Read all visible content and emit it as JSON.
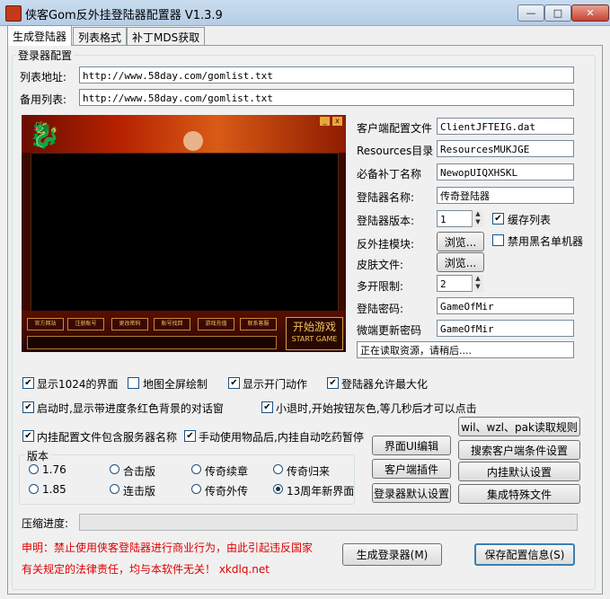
{
  "window": {
    "title": "侠客Gom反外挂登陆器配置器 V1.3.9",
    "min_glyph": "—",
    "max_glyph": "□",
    "close_glyph": "✕",
    "accent": "#c23a19"
  },
  "tabs": [
    "生成登陆器",
    "列表格式",
    "补丁MDS获取"
  ],
  "group_title": "登录器配置",
  "list": {
    "primary_label": "列表地址:",
    "primary_value": "http://www.58day.com/gomlist.txt",
    "backup_label": "备用列表:",
    "backup_value": "http://www.58day.com/gomlist.txt"
  },
  "preview": {
    "min_glyph": "_",
    "close_glyph": "x",
    "buttons": [
      "官方网站",
      "注册账号",
      "更改密码",
      "账号找回",
      "游戏充值",
      "联系客服"
    ],
    "start_line1": "开始游戏",
    "start_line2": "START GAME"
  },
  "right": {
    "client_config_label": "客户端配置文件",
    "client_config_value": "ClientJFTEIG.dat",
    "resources_label": "Resources目录",
    "resources_value": "ResourcesMUKJGE",
    "patch_label": "必备补丁名称",
    "patch_value": "NewopUIQXHSKL",
    "launcher_name_label": "登陆器名称:",
    "launcher_name_value": "传奇登陆器",
    "version_label": "登陆器版本:",
    "version_value": "1",
    "cache_list_label": "缓存列表",
    "anti_cheat_label": "反外挂模块:",
    "browse1": "浏览...",
    "blacklist_label": "禁用黑名单机器",
    "skin_label": "皮肤文件:",
    "browse2": "浏览...",
    "multi_label": "多开限制:",
    "multi_value": "2",
    "password_label": "登陆密码:",
    "password_value": "GameOfMir",
    "update_pw_label": "微端更新密码",
    "update_pw_value": "GameOfMir",
    "status_value": "正在读取资源，请稍后...."
  },
  "checks": [
    {
      "label": "显示1024的界面",
      "checked": true
    },
    {
      "label": "地图全屏绘制",
      "checked": false
    },
    {
      "label": "显示开门动作",
      "checked": true
    },
    {
      "label": "登陆器允许最大化",
      "checked": true
    },
    {
      "label": "启动时,显示带进度条红色背景的对话窗",
      "checked": true
    },
    {
      "label": "小退时,开始按钮灰色,等几秒后才可以点击",
      "checked": true
    },
    {
      "label": "内挂配置文件包含服务器名称",
      "checked": true
    },
    {
      "label": "手动使用物品后,内挂自动吃药暂停",
      "checked": true
    }
  ],
  "version_group": {
    "title": "版本",
    "options": [
      "1.76",
      "合击版",
      "传奇续章",
      "传奇归来",
      "1.85",
      "连击版",
      "传奇外传",
      "13周年新界面"
    ],
    "selected_index": 7
  },
  "buttons": {
    "ui_edit": "界面UI编辑",
    "client_plugin": "客户端插件",
    "launcher_default": "登录器默认设置",
    "wil_rules": "wil、wzl、pak读取规则",
    "search_client": "搜索客户端条件设置",
    "inner_default": "内挂默认设置",
    "special_files": "集成特殊文件",
    "generate": "生成登录器(M)",
    "save": "保存配置信息(S)"
  },
  "progress": {
    "label": "压缩进度:",
    "value": 0
  },
  "disclaimer": {
    "line1": "申明：禁止使用侠客登陆器进行商业行为，由此引起违反国家",
    "line2": "有关规定的法律责任，均与本软件无关！ xkdlq.net",
    "color": "#e00000"
  }
}
